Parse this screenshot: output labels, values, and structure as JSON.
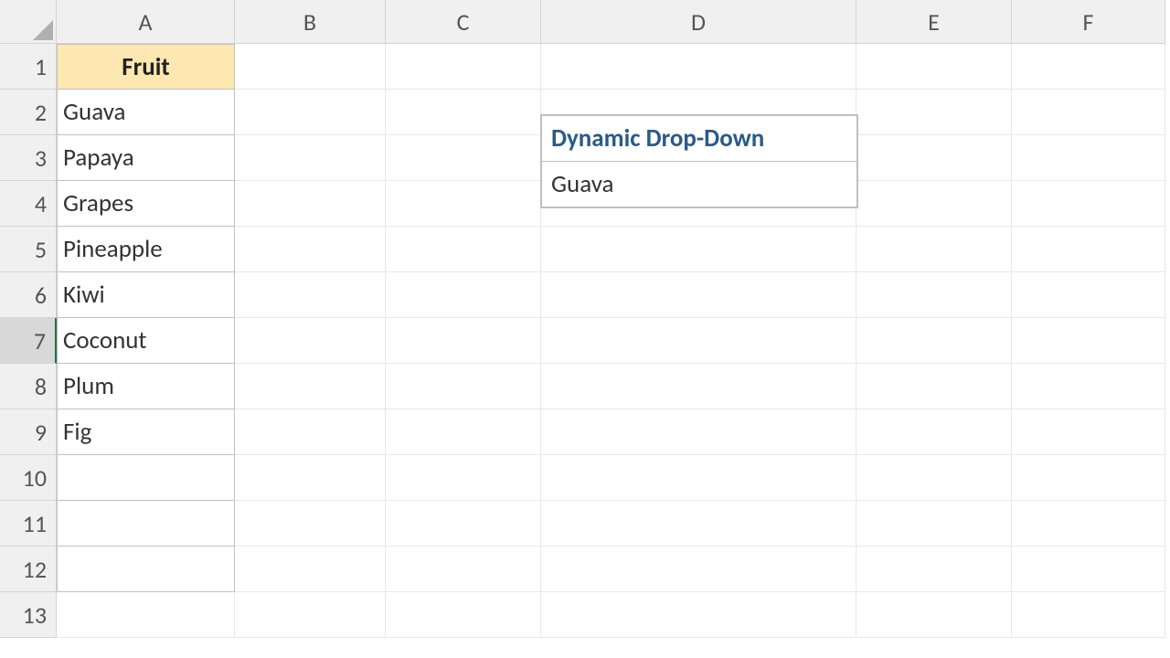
{
  "columns": [
    "A",
    "B",
    "C",
    "D",
    "E",
    "F"
  ],
  "rows": [
    "1",
    "2",
    "3",
    "4",
    "5",
    "6",
    "7",
    "8",
    "9",
    "10",
    "11",
    "12",
    "13"
  ],
  "selectedRow": 7,
  "tableHeader": "Fruit",
  "fruits": [
    "Guava",
    "Papaya",
    "Grapes",
    "Pineapple",
    "Kiwi",
    "Coconut",
    "Plum",
    "Fig"
  ],
  "dropdown": {
    "title": "Dynamic Drop-Down",
    "value": "Guava"
  },
  "colors": {
    "headerFill": "#fce8b0",
    "dropdownTitle": "#2a5a8a",
    "gridLine": "#e8e8e8",
    "border": "#c0c0c0"
  }
}
